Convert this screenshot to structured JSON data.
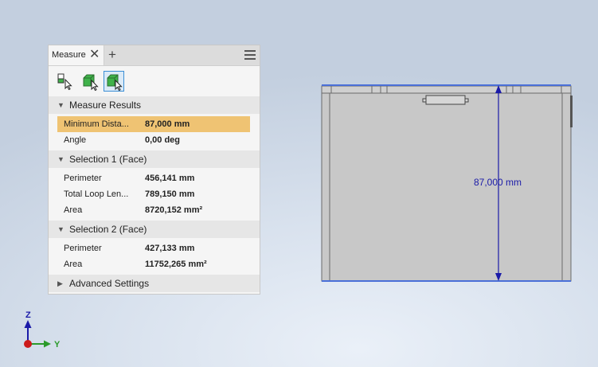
{
  "panel": {
    "tab_title": "Measure",
    "tab_close": "✕",
    "tab_add": "+",
    "tools": [
      "measure-distance-icon",
      "measure-face-icon",
      "measure-face-selected-icon"
    ],
    "sections": {
      "results": {
        "title": "Measure Results",
        "rows": [
          {
            "label": "Minimum Dista...",
            "value": "87,000 mm"
          },
          {
            "label": "Angle",
            "value": "0,00 deg"
          }
        ]
      },
      "selection1": {
        "title": "Selection 1 (Face)",
        "rows": [
          {
            "label": "Perimeter",
            "value": "456,141 mm"
          },
          {
            "label": "Total Loop Len...",
            "value": "789,150 mm"
          },
          {
            "label": "Area",
            "value": "8720,152 mm²"
          }
        ]
      },
      "selection2": {
        "title": "Selection 2 (Face)",
        "rows": [
          {
            "label": "Perimeter",
            "value": "427,133 mm"
          },
          {
            "label": "Area",
            "value": "11752,265 mm²"
          }
        ]
      },
      "advanced": {
        "title": "Advanced Settings"
      }
    }
  },
  "viewport": {
    "dimension_label": "87,000 mm",
    "axes": {
      "z": "Z",
      "y": "Y"
    }
  },
  "colors": {
    "highlight": "#efc373",
    "dimension": "#1a1aa8",
    "part_face": "#c8c8c8",
    "selection_edge": "#4a6fd8"
  }
}
